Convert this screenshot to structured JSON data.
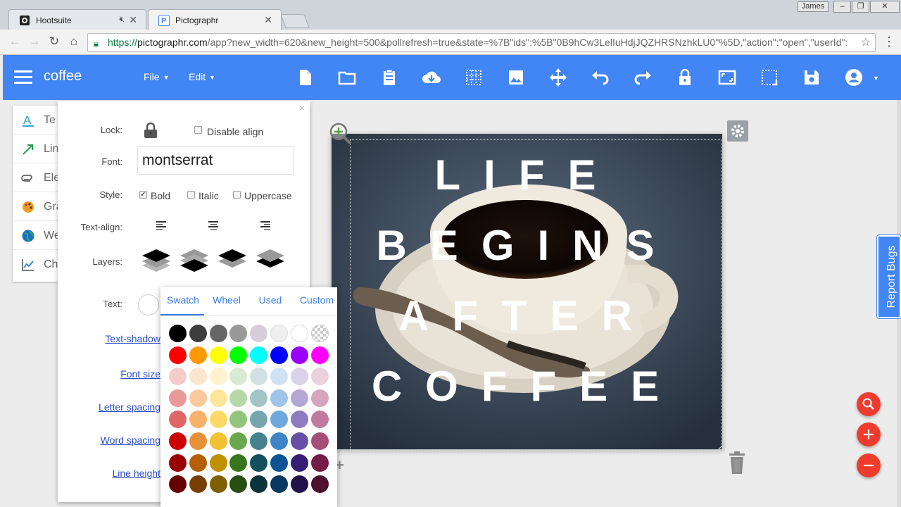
{
  "browser": {
    "tabs": [
      {
        "label": "Hootsuite",
        "active": false
      },
      {
        "label": "Pictographr",
        "active": true
      }
    ],
    "user": "James",
    "url": {
      "scheme": "https://",
      "domain": "pictographr.com",
      "path": "/app?new_width=620&new_height=500&pollrefresh=true&state=%7B\"ids\":%5B\"0B9hCw3LelIuHdjJQZHRSNzhkLU0\"%5D,\"action\":\"open\",\"userId\":"
    }
  },
  "app": {
    "title": "coffee",
    "menus": [
      "File",
      "Edit"
    ],
    "accent": "#4285f4",
    "toolbar_icons": [
      "new-document-icon",
      "open-folder-icon",
      "clipboard-icon",
      "cloud-download-icon",
      "grid-icon",
      "image-icon",
      "move-icon",
      "undo-icon",
      "redo-icon",
      "lock-icon",
      "fit-screen-icon",
      "crop-icon",
      "save-icon",
      "account-icon"
    ]
  },
  "sidebar": {
    "items": [
      {
        "label": "Te",
        "icon": "text-icon"
      },
      {
        "label": "Lin",
        "icon": "line-icon"
      },
      {
        "label": "Ele",
        "icon": "paperclip-icon"
      },
      {
        "label": "Gra",
        "icon": "palette-icon"
      },
      {
        "label": "We",
        "icon": "globe-icon"
      },
      {
        "label": "Ch",
        "icon": "chart-icon"
      }
    ]
  },
  "props": {
    "close": "×",
    "lock_label": "Lock:",
    "disable_align_label": "Disable align",
    "font_label": "Font:",
    "font_value": "montserrat",
    "style_label": "Style:",
    "bold_label": "Bold",
    "bold_checked": "✓",
    "italic_label": "Italic",
    "uppercase_label": "Uppercase",
    "text_align_label": "Text-align:",
    "layers_label": "Layers:",
    "text_label": "Text:",
    "links": [
      "Text-shadow",
      "Font size",
      "Letter spacing",
      "Word spacing",
      "Line height"
    ]
  },
  "canvas": {
    "lines": [
      "LIFE",
      "BEGINS",
      "AFTER",
      "COFFEE"
    ]
  },
  "report_bugs": "Report Bugs",
  "picker": {
    "tabs": [
      "Swatch",
      "Wheel",
      "Used",
      "Custom"
    ],
    "rows": [
      [
        "#000000",
        "#3d3d3d",
        "#666666",
        "#999999",
        "#d6cfd9",
        "#efefef",
        "#ffffff",
        "transparent"
      ],
      [
        "#ff0000",
        "#ff9900",
        "#ffff00",
        "#00ff00",
        "#00ffff",
        "#0000ff",
        "#9900ff",
        "#ff00ff"
      ],
      [
        "#f4cccc",
        "#fce5cd",
        "#fff2cc",
        "#d9ead3",
        "#d0e0e3",
        "#cfe2f3",
        "#d9d2e9",
        "#ead1dc"
      ],
      [
        "#ea9999",
        "#f9cb9c",
        "#ffe599",
        "#b6d7a8",
        "#a2c4c9",
        "#9fc5e8",
        "#b4a7d6",
        "#d5a6bd"
      ],
      [
        "#e06666",
        "#f6b26b",
        "#ffd966",
        "#93c47d",
        "#76a5af",
        "#6fa8dc",
        "#8e7cc3",
        "#c27ba0"
      ],
      [
        "#cc0000",
        "#e69138",
        "#f1c232",
        "#6aa84f",
        "#45818e",
        "#3d85c6",
        "#674ea7",
        "#a64d79"
      ],
      [
        "#990000",
        "#b45f06",
        "#bf9000",
        "#38761d",
        "#134f5c",
        "#0b5394",
        "#351c75",
        "#741b47"
      ],
      [
        "#660000",
        "#783f04",
        "#7f6000",
        "#274e13",
        "#0c343d",
        "#073763",
        "#20124d",
        "#4c1130"
      ]
    ]
  }
}
